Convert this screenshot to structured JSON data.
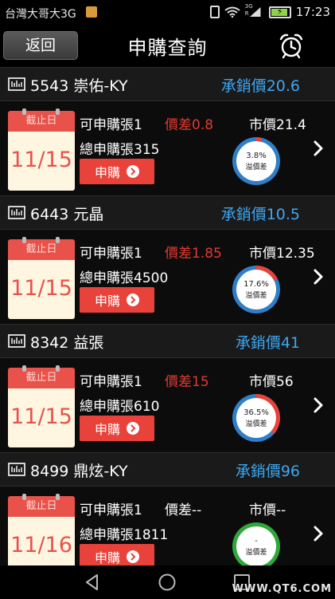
{
  "status_bar": {
    "carrier": "台灣大哥大3G",
    "network": "3G",
    "signal_label": "R",
    "time": "17:23",
    "battery_color": "#8fd24a"
  },
  "header": {
    "back_label": "返回",
    "title": "申購查詢",
    "alarm_icon": "alarm-clock-icon"
  },
  "labels": {
    "calendar_title": "截止日",
    "subscribe_button": "申購",
    "ring_caption": "溢價差"
  },
  "stocks": [
    {
      "name": "5543 崇佑-KY",
      "offer_price": "承銷價20.6",
      "deadline": "11/15",
      "available": "可申購張1",
      "price_diff": "價差0.8",
      "price_diff_red": true,
      "total": "總申購張315",
      "market_price": "市價21.4",
      "premium_text": "3.8%",
      "premium_value": 3.8,
      "ring_outer": "#2f7fc8"
    },
    {
      "name": "6443 元晶",
      "offer_price": "承銷價10.5",
      "deadline": "11/15",
      "available": "可申購張1",
      "price_diff": "價差1.85",
      "price_diff_red": true,
      "total": "總申購張4500",
      "market_price": "市價12.35",
      "premium_text": "17.6%",
      "premium_value": 17.6,
      "ring_outer": "#2f7fc8"
    },
    {
      "name": "8342 益張",
      "offer_price": "承銷價41",
      "deadline": "11/15",
      "available": "可申購張1",
      "price_diff": "價差15",
      "price_diff_red": true,
      "total": "總申購張610",
      "market_price": "市價56",
      "premium_text": "36.5%",
      "premium_value": 36.5,
      "ring_outer": "#2f7fc8"
    },
    {
      "name": "8499 鼎炫-KY",
      "offer_price": "承銷價96",
      "deadline": "11/16",
      "available": "可申購張1",
      "price_diff": "價差--",
      "price_diff_red": false,
      "total": "總申購張1811",
      "market_price": "市價--",
      "premium_text": "-",
      "premium_value": 0,
      "ring_outer": "#2fa83a"
    }
  ],
  "colors": {
    "offer_price": "#3ea6f0",
    "price_diff": "#e23a32",
    "calendar_red": "#e8524a",
    "premium_red": "#e8423a"
  },
  "nav": {
    "back_icon": "triangle-back-icon",
    "home_icon": "circle-home-icon",
    "recents_icon": "square-recents-icon"
  },
  "watermark": "WWW.QT6.COM"
}
